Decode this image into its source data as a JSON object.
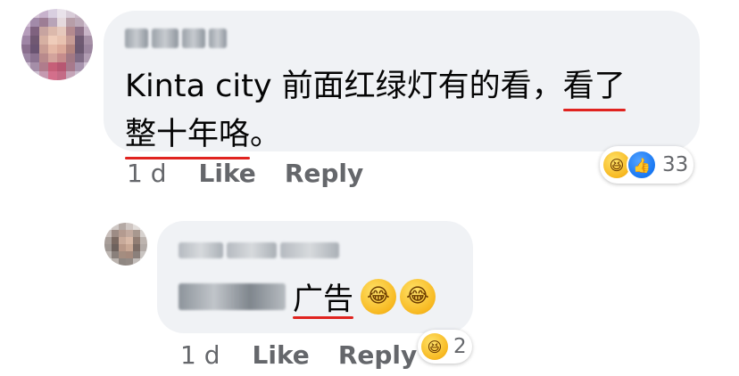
{
  "comments": [
    {
      "author": "",
      "text_part1": "Kinta city 前面红绿灯有的看，",
      "text_underlined1": "看了",
      "text_underlined2": "整十年咯",
      "text_end": "。",
      "time": "1 d",
      "like_label": "Like",
      "reply_label": "Reply",
      "reactions": [
        "haha-emoji-icon",
        "like-reaction-icon"
      ],
      "reaction_count": "33"
    },
    {
      "author": "",
      "text_blurred": "",
      "text_underlined": "广告",
      "emoji": [
        "haha-emoji-icon",
        "haha-emoji-icon"
      ],
      "time": "1 d",
      "like_label": "Like",
      "reply_label": "Reply",
      "reactions": [
        "haha-emoji-icon"
      ],
      "reaction_count": "2"
    }
  ],
  "colors": {
    "bubble": "#f0f2f5",
    "text": "#050505",
    "secondary_text": "#65676b",
    "underline": "#e0231f",
    "like_blue": "#1877f2"
  }
}
